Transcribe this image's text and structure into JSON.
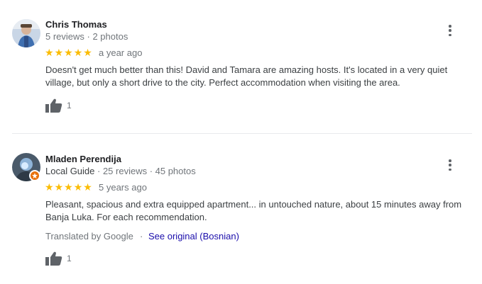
{
  "reviews": [
    {
      "author": "Chris Thomas",
      "meta": "5 reviews · 2 photos",
      "rating": 5,
      "stars": [
        "★",
        "★",
        "★",
        "★",
        "★"
      ],
      "date": "a year ago",
      "text": "Doesn't get much better than this! David and Tamara are amazing hosts. It's located in a very quiet village, but only a short drive to the city. Perfect accommodation when visiting the area.",
      "likes": "1",
      "avatar_icon": "user-photo-avatar"
    },
    {
      "author": "Mladen Perendija",
      "badge": "Local Guide",
      "meta": " · 25 reviews · 45 photos",
      "rating": 5,
      "stars": [
        "★",
        "★",
        "★",
        "★",
        "★"
      ],
      "date": "5 years ago",
      "text": "Pleasant, spacious and extra equipped apartment... in untouched nature, about 15 minutes away from Banja Luka. For each recommendation.",
      "translated_label": "Translated by Google",
      "separator": "·",
      "see_original_label": "See original (Bosnian)",
      "likes": "1",
      "avatar_icon": "user-photo-avatar",
      "badge_icon": "local-guide-star-icon"
    }
  ],
  "colors": {
    "star": "#fbbc04",
    "link": "#1a0dab",
    "muted": "#70757a",
    "local_guide_badge": "#e8710a"
  }
}
